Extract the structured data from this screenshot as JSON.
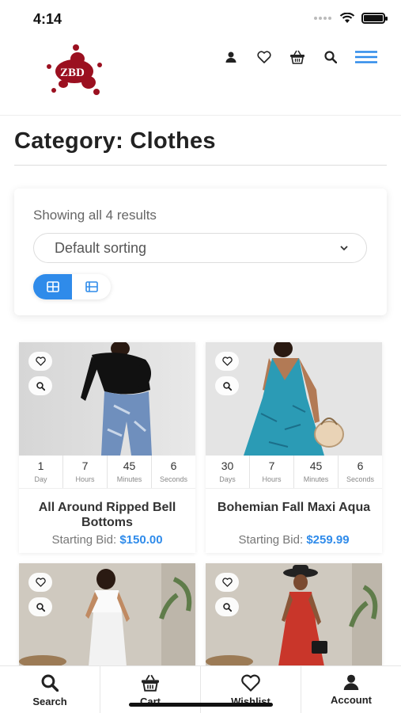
{
  "status_bar": {
    "time": "4:14"
  },
  "header": {
    "logo_text": "ZBD",
    "icons": [
      "account-icon",
      "wishlist-icon",
      "cart-icon",
      "search-icon",
      "menu-icon"
    ],
    "accent_color": "#2f8bea",
    "logo_color": "#9b1020"
  },
  "page": {
    "title": "Category: Clothes",
    "results_count": "Showing all 4 results",
    "sort_value": "Default sorting"
  },
  "products": [
    {
      "name": "All Around Ripped Bell Bottoms",
      "bid_label": "Starting Bid:",
      "price": "$150.00",
      "countdown": [
        {
          "value": "1",
          "label": "Day"
        },
        {
          "value": "7",
          "label": "Hours"
        },
        {
          "value": "45",
          "label": "Minutes"
        },
        {
          "value": "6",
          "label": "Seconds"
        }
      ]
    },
    {
      "name": "Bohemian Fall Maxi Aqua",
      "bid_label": "Starting Bid:",
      "price": "$259.99",
      "countdown": [
        {
          "value": "30",
          "label": "Days"
        },
        {
          "value": "7",
          "label": "Hours"
        },
        {
          "value": "45",
          "label": "Minutes"
        },
        {
          "value": "6",
          "label": "Seconds"
        }
      ]
    }
  ],
  "bottom_nav": [
    {
      "label": "Search",
      "icon": "search-icon"
    },
    {
      "label": "Cart",
      "icon": "cart-icon"
    },
    {
      "label": "Wishlist",
      "icon": "heart-icon"
    },
    {
      "label": "Account",
      "icon": "account-icon"
    }
  ]
}
